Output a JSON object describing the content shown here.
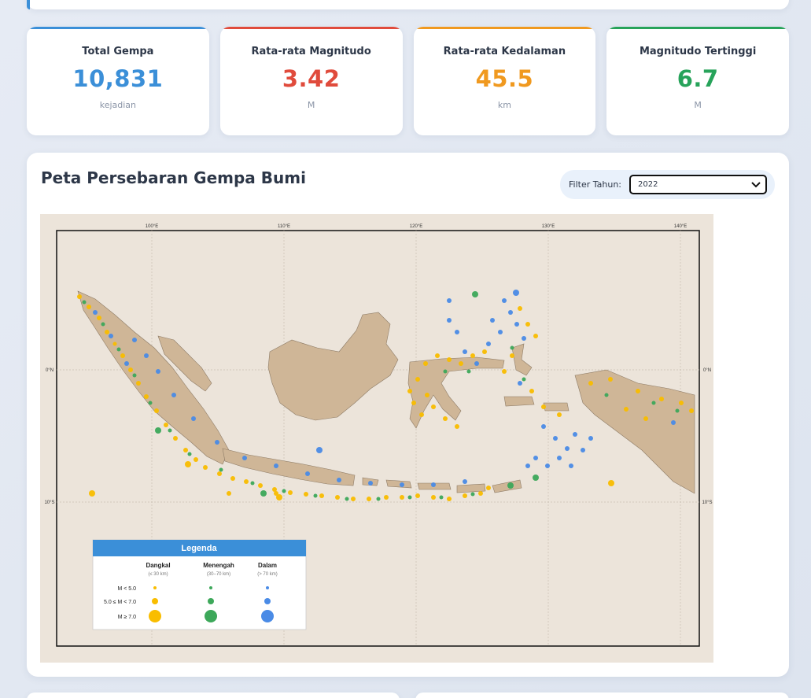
{
  "stats": [
    {
      "label": "Total Gempa",
      "value": "10,831",
      "unit": "kejadian",
      "color": "#3b8fd8"
    },
    {
      "label": "Rata-rata Magnitudo",
      "value": "3.42",
      "unit": "M",
      "color": "#e04b3c"
    },
    {
      "label": "Rata-rata Kedalaman",
      "value": "45.5",
      "unit": "km",
      "color": "#f0991f"
    },
    {
      "label": "Magnitudo Tertinggi",
      "value": "6.7",
      "unit": "M",
      "color": "#27a35a"
    }
  ],
  "map_panel": {
    "title": "Peta Persebaran Gempa Bumi",
    "filter_label": "Filter Tahun:",
    "filter_value": "2022",
    "lon_ticks": [
      "100°E",
      "110°E",
      "120°E",
      "130°E",
      "140°E"
    ],
    "lat_ticks": [
      "0°N",
      "10°S"
    ],
    "legend": {
      "title": "Legenda",
      "depth_classes": [
        {
          "name": "Dangkal",
          "range": "(≤ 30 km)",
          "color": "#f9bd00"
        },
        {
          "name": "Menengah",
          "range": "(30–70 km)",
          "color": "#3da85a"
        },
        {
          "name": "Dalam",
          "range": "(> 70 km)",
          "color": "#4a8be6"
        }
      ],
      "magnitude_classes": [
        "M < 5.0",
        "5.0 ≤ M < 7.0",
        "M ≥ 7.0"
      ]
    }
  }
}
